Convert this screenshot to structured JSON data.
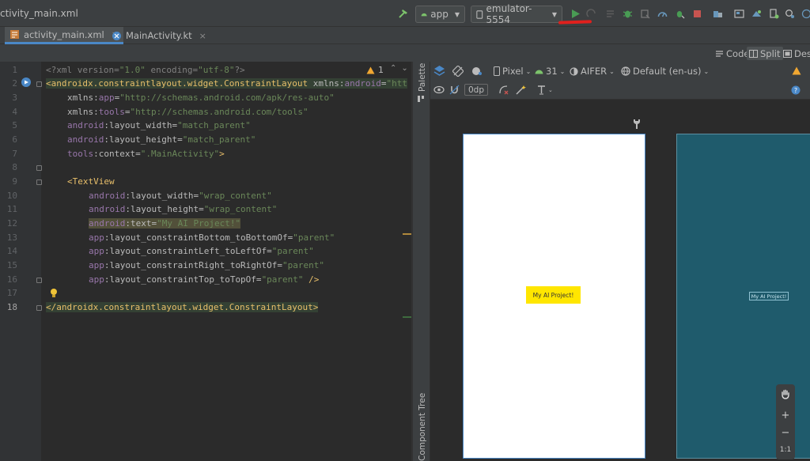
{
  "window": {
    "title": "ctivity_main.xml"
  },
  "toolbar": {
    "run_config": "app",
    "device": "emulator-5554"
  },
  "tabs": [
    {
      "label": "activity_main.xml",
      "close": "×"
    },
    {
      "label": "MainActivity.kt",
      "close": "×"
    }
  ],
  "view_modes": {
    "code": "Code",
    "split": "Split",
    "design": "Desi"
  },
  "editor": {
    "warnings": {
      "count": "1"
    },
    "line_numbers": [
      "1",
      "2",
      "3",
      "4",
      "5",
      "6",
      "7",
      "8",
      "9",
      "10",
      "11",
      "12",
      "13",
      "14",
      "15",
      "16",
      "17",
      "18"
    ],
    "lines": [
      [
        "<?xml version=",
        "\"1.0\"",
        " encoding=",
        "\"utf-8\"",
        "?>"
      ],
      [
        "<androidx.constraintlayout.widget.ConstraintLayout",
        " xmlns:",
        "android",
        "=",
        "\"htt"
      ],
      [
        "xmlns:",
        "app",
        "=",
        "\"http://schemas.android.com/apk/res-auto\""
      ],
      [
        "xmlns:",
        "tools",
        "=",
        "\"http://schemas.android.com/tools\""
      ],
      [
        "android",
        ":layout_width=",
        "\"match_parent\""
      ],
      [
        "android",
        ":layout_height=",
        "\"match_parent\""
      ],
      [
        "tools",
        ":context=",
        "\".MainActivity\"",
        ">"
      ],
      [],
      [
        "<TextView"
      ],
      [
        "android",
        ":layout_width=",
        "\"wrap_content\""
      ],
      [
        "android",
        ":layout_height=",
        "\"wrap_content\""
      ],
      [
        "android",
        ":text=",
        "\"My AI Project!\""
      ],
      [
        "app",
        ":layout_constraintBottom_toBottomOf=",
        "\"parent\""
      ],
      [
        "app",
        ":layout_constraintLeft_toLeftOf=",
        "\"parent\""
      ],
      [
        "app",
        ":layout_constraintRight_toRightOf=",
        "\"parent\""
      ],
      [
        "app",
        ":layout_constraintTop_toTopOf=",
        "\"parent\"",
        " />"
      ],
      [],
      [
        "</androidx.constraintlayout.widget.ConstraintLayout>"
      ]
    ]
  },
  "palette": {
    "label": "Palette",
    "component_tree": "Component Tree"
  },
  "design_toolbar": {
    "device": "Pixel",
    "api": "31",
    "theme": "AIFER",
    "locale": "Default (en-us)",
    "margin": "0dp"
  },
  "preview": {
    "textview_text": "My AI Project!",
    "zoom_in": "+",
    "zoom_out": "−",
    "zoom_reset": "1:1"
  },
  "colors": {
    "accent": "#4a88c7",
    "run_green": "#499c54",
    "stop_red": "#c75450",
    "annotation_red": "#e0201d",
    "textview_yellow": "#ffe600",
    "blueprint": "#1f5b6c"
  }
}
